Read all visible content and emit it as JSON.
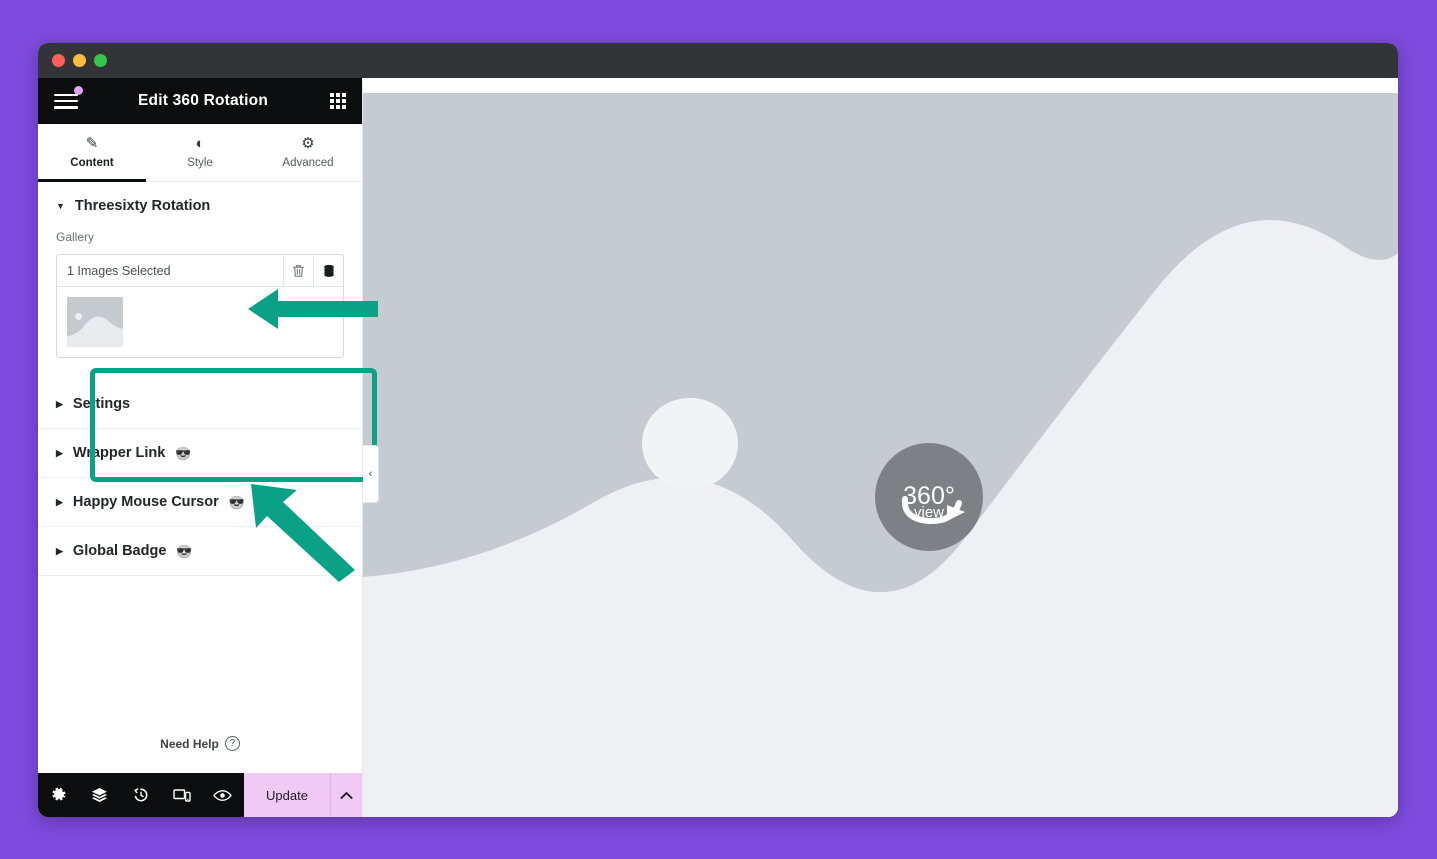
{
  "theme": {
    "page_background": "#7e4bde",
    "panel_header_bg": "#0c0d0e",
    "accent_teal": "#0ba186",
    "update_button_bg": "#f0c9f5",
    "canvas_placeholder_gray": "#c5cbd0",
    "badge_gray": "#7d8186"
  },
  "window": {
    "traffic_lights": [
      "close",
      "minimize",
      "zoom"
    ]
  },
  "panel": {
    "header": {
      "title": "Edit 360 Rotation",
      "menu_icon": "hamburger-icon",
      "notification_dot": true,
      "apps_icon": "grid-apps-icon"
    },
    "tabs": [
      {
        "label": "Content",
        "icon": "pencil-icon",
        "glyph": "✎",
        "active": true
      },
      {
        "label": "Style",
        "icon": "contrast-icon",
        "glyph": "◐",
        "active": false
      },
      {
        "label": "Advanced",
        "icon": "gear-icon",
        "glyph": "⚙",
        "active": false
      }
    ],
    "sections": [
      {
        "title": "Threesixty Rotation",
        "open": true,
        "caret": "▼",
        "pro": false
      },
      {
        "title": "Settings",
        "open": false,
        "caret": "▶",
        "pro": false
      },
      {
        "title": "Wrapper Link",
        "open": false,
        "caret": "▶",
        "pro": true,
        "pro_icon": "😎"
      },
      {
        "title": "Happy Mouse Cursor",
        "open": false,
        "caret": "▶",
        "pro": true,
        "pro_icon": "😎"
      },
      {
        "title": "Global Badge",
        "open": false,
        "caret": "▶",
        "pro": true,
        "pro_icon": "😎"
      }
    ],
    "gallery": {
      "label": "Gallery",
      "count_text": "1 Images Selected",
      "delete_icon": "trash-icon",
      "stack_icon": "database-stack-icon",
      "thumbnails": [
        "image-placeholder"
      ]
    },
    "need_help": {
      "label": "Need Help",
      "icon": "question-circle-icon",
      "glyph": "?"
    },
    "footer": {
      "tools": [
        {
          "name": "settings",
          "icon": "gear-icon",
          "glyph": "⚙"
        },
        {
          "name": "navigator",
          "icon": "layers-icon",
          "glyph": "☰"
        },
        {
          "name": "history",
          "icon": "history-clock-icon",
          "glyph": "↺"
        },
        {
          "name": "responsive",
          "icon": "responsive-mode-icon",
          "glyph": "▭"
        },
        {
          "name": "preview",
          "icon": "eye-preview-icon",
          "glyph": "◉"
        }
      ],
      "update_label": "Update",
      "update_caret": "⌃"
    },
    "collapse_handle": {
      "icon": "chevron-left-icon",
      "glyph": "‹"
    }
  },
  "canvas": {
    "badge": {
      "degrees_text": "360°",
      "view_text": "view",
      "arrow_icon": "rotate-arrow-icon"
    },
    "placeholder": {
      "sun": "circle-sun-shape",
      "hill": "wave-hill-shape"
    }
  },
  "annotations": [
    {
      "name": "arrow-pointing-to-threesixty-rotation",
      "direction": "left",
      "color": "#0ba186"
    },
    {
      "name": "arrow-pointing-to-gallery",
      "direction": "up-left",
      "color": "#0ba186"
    },
    {
      "name": "highlight-box-gallery",
      "shape": "rectangle",
      "color": "#0ba186"
    }
  ]
}
